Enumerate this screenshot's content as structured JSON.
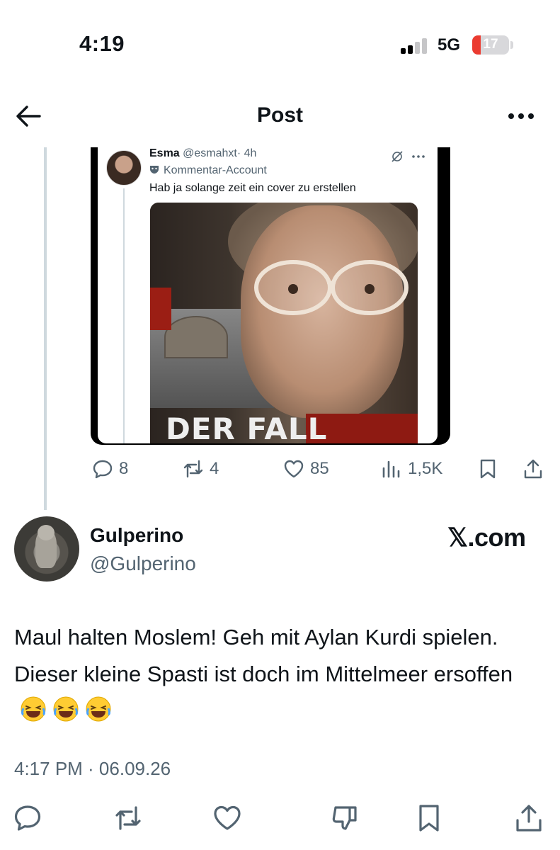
{
  "status_bar": {
    "time": "4:19",
    "network": "5G",
    "battery": "17",
    "battery_color": "#eb3b30"
  },
  "header": {
    "back_icon": "arrow-left-icon",
    "title": "Post",
    "more_icon": "more-horizontal-icon"
  },
  "quoted_screenshot": {
    "author_name": "Esma",
    "author_handle": "@esmahxt",
    "time_ago": "· 4h",
    "account_label": "Kommentar-Account",
    "text": "Hab ja solange zeit ein cover zu erstellen",
    "image_title": "DER FALL",
    "icons": [
      "mute-icon",
      "more-horizontal-icon",
      "mask-icon"
    ]
  },
  "parent_actions": {
    "replies": "8",
    "reposts": "4",
    "likes": "85",
    "views": "1,5K",
    "icons": [
      "reply-icon",
      "repost-icon",
      "like-icon",
      "views-icon",
      "bookmark-icon",
      "share-icon"
    ]
  },
  "reply": {
    "name": "Gulperino",
    "handle": "@Gulperino",
    "watermark": "𝕏.com",
    "text": "Maul halten Moslem! Geh mit Aylan Kurdi spielen. Dieser kleine Spasti ist doch im Mittelmeer ersoffen",
    "emojis": [
      "😂",
      "😂",
      "😂"
    ],
    "timestamp": "4:17 PM · 06.09.26"
  },
  "bottom_actions": {
    "icons": [
      "reply-icon",
      "repost-icon",
      "like-icon",
      "dislike-icon",
      "bookmark-icon",
      "share-icon"
    ]
  },
  "colors": {
    "text": "#0f1419",
    "secondary": "#536471",
    "thread_line": "#cfd9de"
  }
}
